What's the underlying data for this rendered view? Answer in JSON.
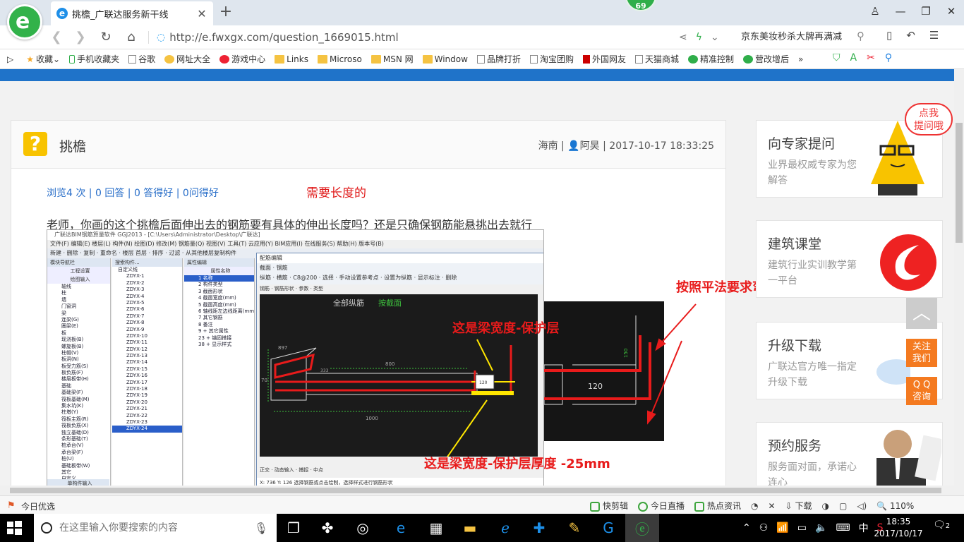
{
  "browser": {
    "tab_title": "挑檐_广联达服务新干线",
    "badge_count": "69",
    "url": "http://e.fwxgx.com/question_1669015.html",
    "hot_search": "京东美妆秒杀大牌再满减",
    "bookmarks": [
      "收藏",
      "手机收藏夹",
      "谷歌",
      "网址大全",
      "游戏中心",
      "Links",
      "Microso",
      "MSN 网",
      "Window",
      "品牌打折",
      "淘宝团购",
      "外国网友",
      "天猫商城",
      "精准控制",
      "营改增后"
    ]
  },
  "question": {
    "title": "挑檐",
    "region": "海南",
    "author": "阿昊",
    "datetime": "2017-10-17 18:33:25",
    "stats": "浏览4 次 | 0 回答 | 0 答得好 | 0问得好",
    "body": "老师，你画的这个挑檐后面伸出去的钢筋要有具体的伸出长度吗？还是只确保钢筋能悬挑出去就行"
  },
  "annotations": {
    "need_length": "需要长度的",
    "beam_width_cover": "这是梁宽度-保护层",
    "beam_width_cover_thickness": "这是梁宽度-保护层厚度 -25mm",
    "bend_15d": "按照平法要求弯折15d"
  },
  "embedded": {
    "title": "广联达BIM钢筋算量软件 GGJ2013 - [C:\\Users\\Administrator\\Desktop\\广联达]",
    "menu": "文件(F)  编辑(E)  楼层(L)  构件(N)  绘图(D)  修改(M)  钢筋量(Q)  视图(V)  工具(T)  云应用(Y)  BIM应用(I)  在线服务(S)  帮助(H)  版本号(B)",
    "toolbar": "新建 · 删除 · 复制 · 重命名 · 楼层 首层 · 排序 · 过滤 · 从其他楼层复制构件",
    "panel1_header": "模块导航栏",
    "panel1_sub1": "工程设置",
    "panel1_sub2": "绘图输入",
    "panel1_tree": [
      "轴线",
      "柱",
      "墙",
      "门窗洞",
      "梁",
      "连梁(G)",
      "圈梁(E)",
      "板",
      "现浇板(B)",
      "螺旋板(B)",
      "柱帽(V)",
      "板洞(N)",
      "板受力筋(S)",
      "板负筋(F)",
      "楼层板带(H)",
      "基础",
      "基础梁(F)",
      "筏板基础(M)",
      "集水坑(K)",
      "柱墩(Y)",
      "筏板主筋(R)",
      "筏板负筋(X)",
      "独立基础(D)",
      "条形基础(T)",
      "桩承台(V)",
      "承台梁(F)",
      "桩(U)",
      "基础板带(W)",
      "其它",
      "自定义",
      "自定义点",
      "自定义线(X)",
      "自定义面",
      "尺寸标注(W)"
    ],
    "panel1_footer": "单构件输入",
    "panel2_search": "搜索构件...",
    "panel2_root": "自定义线",
    "panel2_items": [
      "ZDYX-1",
      "ZDYX-2",
      "ZDYX-3",
      "ZDYX-4",
      "ZDYX-5",
      "ZDYX-6",
      "ZDYX-7",
      "ZDYX-8",
      "ZDYX-9",
      "ZDYX-10",
      "ZDYX-11",
      "ZDYX-12",
      "ZDYX-13",
      "ZDYX-14",
      "ZDYX-15",
      "ZDYX-16",
      "ZDYX-17",
      "ZDYX-18",
      "ZDYX-19",
      "ZDYX-20",
      "ZDYX-21",
      "ZDYX-22",
      "ZDYX-23",
      "ZDYX-24"
    ],
    "panel3_header": "属性编辑",
    "panel3_col": "属性名称",
    "panel3_rows": [
      "1 名称",
      "2 构件类型",
      "3 截面形状",
      "4 截面宽度(mm)",
      "5 截面高度(mm)",
      "6 轴线距左边线距离(mm)",
      "7 其它钢筋",
      "8 备注",
      "9 + 其它属性",
      "23 + 锚固搭接",
      "38 + 显示样式"
    ],
    "dialog_title": "配筋编辑",
    "dialog_tabs": "截面  · 钢筋",
    "dialog_bar": "纵筋 · 横筋 · C8@200 · 选择 · 手动设置参考点 · 设置为纵筋 · 显示标注 · 删除",
    "dialog_bar2": "钢筋 · 钢筋形状 · 参数 · 类型",
    "cad_label": "全部纵筋",
    "cad_label2": "按截面",
    "cad_dims": {
      "d1": "897",
      "d2": "800",
      "d3": "1000",
      "d4": "120",
      "d5": "70",
      "d6": "333"
    },
    "dialog_status": "X: 736 Y: 126     选择钢筋或点击绘制，选择样式进行钢筋形状",
    "dialog_tabs_bottom": "正交 · 动态输入 · 捕捉 · 中点",
    "cad2_dims": {
      "d1": "120",
      "d2": "150"
    }
  },
  "sidebar": {
    "ask": {
      "title": "向专家提问",
      "desc": "业界最权威专家为您解答"
    },
    "course": {
      "title": "建筑课堂",
      "desc": "建筑行业实训教学第一平台"
    },
    "download": {
      "title": "升级下载",
      "desc": "广联达官方唯一指定升级下载"
    },
    "booking": {
      "title": "预约服务",
      "desc": "服务面对面，承诺心连心"
    },
    "bubble": "点我\n提问哦",
    "follow": "关注\n我们",
    "qq": "Q Q\n咨询"
  },
  "statusbar": {
    "today": "今日优选",
    "items": [
      "快剪辑",
      "今日直播",
      "热点资讯",
      "下载"
    ],
    "zoom": "110%"
  },
  "taskbar": {
    "search_placeholder": "在这里输入你要搜索的内容",
    "ime": "中",
    "time": "18:35",
    "date": "2017/10/17",
    "notif_count": "2"
  },
  "colors": {
    "accent_blue": "#1f73c9",
    "annotation_red": "#e81b1b",
    "qicon_yellow": "#f8c300",
    "orange": "#f47a20",
    "green": "#32b24a"
  }
}
